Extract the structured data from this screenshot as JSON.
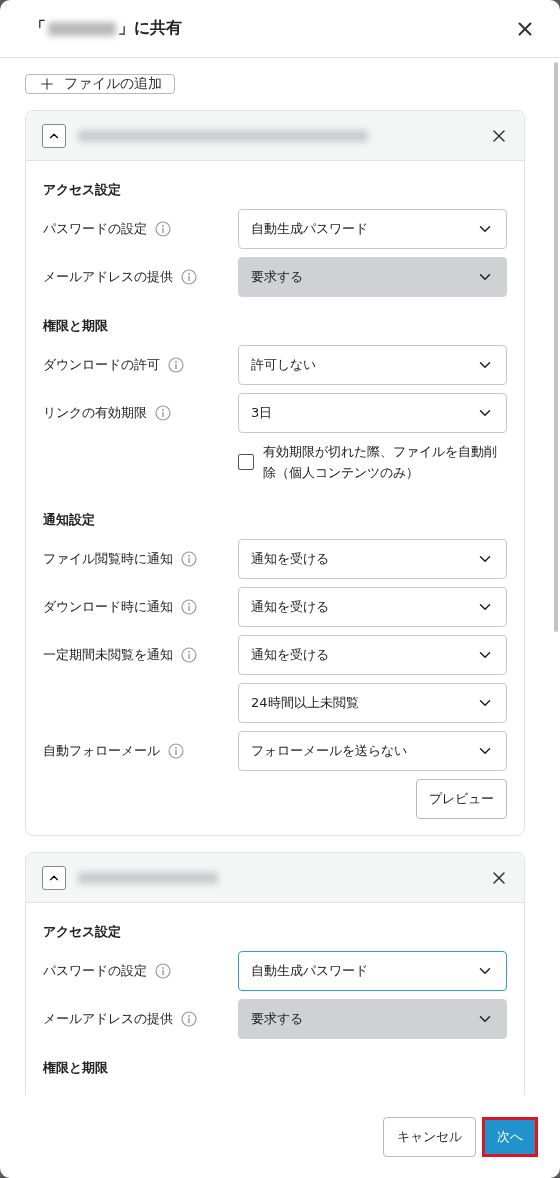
{
  "dialog": {
    "title_prefix": "「",
    "title_suffix": "」に共有",
    "name_redacted": true
  },
  "add_file_button": {
    "label": "ファイルの追加"
  },
  "files": [
    {
      "name_redacted": true,
      "expanded": true,
      "sections": [
        {
          "title": "アクセス設定",
          "items": [
            {
              "kind": "select",
              "label": "パスワードの設定",
              "info": true,
              "value": "自動生成パスワード",
              "disabled": false,
              "focused": false
            },
            {
              "kind": "select",
              "label": "メールアドレスの提供",
              "info": true,
              "value": "要求する",
              "disabled": true,
              "focused": false
            }
          ]
        },
        {
          "title": "権限と期限",
          "items": [
            {
              "kind": "select",
              "label": "ダウンロードの許可",
              "info": true,
              "value": "許可しない",
              "disabled": false,
              "focused": false
            },
            {
              "kind": "select",
              "label": "リンクの有効期限",
              "info": true,
              "value": "3日",
              "disabled": false,
              "focused": false
            },
            {
              "kind": "checkbox",
              "label": "有効期限が切れた際、ファイルを自動削除（個人コンテンツのみ）",
              "checked": false
            }
          ]
        },
        {
          "title": "通知設定",
          "items": [
            {
              "kind": "select",
              "label": "ファイル閲覧時に通知",
              "info": true,
              "value": "通知を受ける",
              "disabled": false,
              "focused": false
            },
            {
              "kind": "select",
              "label": "ダウンロード時に通知",
              "info": true,
              "value": "通知を受ける",
              "disabled": false,
              "focused": false
            },
            {
              "kind": "select",
              "label": "一定期間未閲覧を通知",
              "info": true,
              "value": "通知を受ける",
              "disabled": false,
              "focused": false
            },
            {
              "kind": "select",
              "value": "24時間以上未閲覧",
              "disabled": false,
              "focused": false
            },
            {
              "kind": "select",
              "label": "自動フォローメール",
              "info": true,
              "value": "フォローメールを送らない",
              "disabled": false,
              "focused": false
            },
            {
              "kind": "button",
              "label": "プレビュー"
            }
          ]
        }
      ]
    },
    {
      "name_redacted": true,
      "expanded": true,
      "sections": [
        {
          "title": "アクセス設定",
          "items": [
            {
              "kind": "select",
              "label": "パスワードの設定",
              "info": true,
              "value": "自動生成パスワード",
              "disabled": false,
              "focused": true
            },
            {
              "kind": "select",
              "label": "メールアドレスの提供",
              "info": true,
              "value": "要求する",
              "disabled": true,
              "focused": false
            }
          ]
        },
        {
          "title": "権限と期限"
        }
      ]
    }
  ],
  "footer": {
    "cancel": "キャンセル",
    "next": {
      "label": "次へ",
      "highlighted": true
    }
  }
}
